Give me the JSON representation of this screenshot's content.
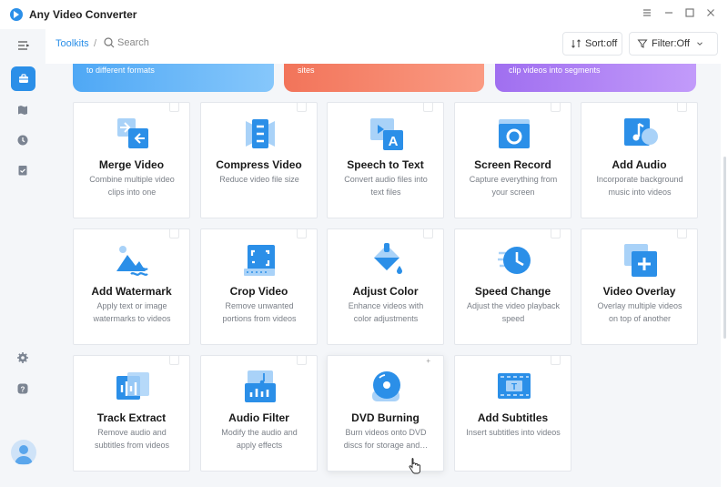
{
  "app": {
    "title": "Any Video Converter"
  },
  "window": {
    "menu_icon": "menu-icon",
    "minimize_icon": "minimize-icon",
    "maximize_icon": "maximize-icon",
    "close_icon": "close-icon"
  },
  "toolbar": {
    "breadcrumb": "Toolkits",
    "separator": "/",
    "search_placeholder": "Search",
    "sort_label": "Sort:off",
    "filter_label": "Filter:Off"
  },
  "sidebar": {
    "items": [
      {
        "icon": "toolbox-icon",
        "active": true
      },
      {
        "icon": "map-icon",
        "active": false
      },
      {
        "icon": "clock-icon",
        "active": false
      },
      {
        "icon": "tasks-icon",
        "active": false
      },
      {
        "icon": "gear-icon",
        "active": false
      },
      {
        "icon": "help-icon",
        "active": false
      }
    ]
  },
  "banners": [
    {
      "text": "to different formats",
      "color": "#4fa8f5"
    },
    {
      "text": "sites",
      "color": "#f2745a"
    },
    {
      "text": "clip videos into segments",
      "color": "#a06ff0"
    }
  ],
  "tools": [
    {
      "title": "Merge Video",
      "desc": "Combine multiple video clips into one",
      "icon": "merge-icon"
    },
    {
      "title": "Compress Video",
      "desc": "Reduce video file size",
      "icon": "compress-icon"
    },
    {
      "title": "Speech to Text",
      "desc": "Convert audio files into text files",
      "icon": "speech-to-text-icon"
    },
    {
      "title": "Screen Record",
      "desc": "Capture everything from your screen",
      "icon": "screen-record-icon"
    },
    {
      "title": "Add Audio",
      "desc": "Incorporate background music into videos",
      "icon": "music-note-icon"
    },
    {
      "title": "Add Watermark",
      "desc": "Apply text or image watermarks to videos",
      "icon": "watermark-icon"
    },
    {
      "title": "Crop Video",
      "desc": "Remove unwanted portions from videos",
      "icon": "crop-icon"
    },
    {
      "title": "Adjust Color",
      "desc": "Enhance videos with color adjustments",
      "icon": "paint-bucket-icon"
    },
    {
      "title": "Speed Change",
      "desc": "Adjust the video playback speed",
      "icon": "speed-clock-icon"
    },
    {
      "title": "Video Overlay",
      "desc": "Overlay multiple videos on top of another",
      "icon": "overlay-plus-icon"
    },
    {
      "title": "Track Extract",
      "desc": "Remove audio and subtitles from videos",
      "icon": "waveform-icon"
    },
    {
      "title": "Audio Filter",
      "desc": "Modify the audio and apply effects",
      "icon": "audio-filter-icon"
    },
    {
      "title": "DVD Burning",
      "desc": "Burn videos onto DVD discs for storage and…",
      "icon": "disc-icon"
    },
    {
      "title": "Add Subtitles",
      "desc": "Insert subtitles into videos",
      "icon": "subtitles-icon"
    }
  ],
  "colors": {
    "accent": "#2b8fe8",
    "icon_light": "#a9d2f8",
    "card_border": "#e4e7ec",
    "background": "#f4f6f9"
  }
}
